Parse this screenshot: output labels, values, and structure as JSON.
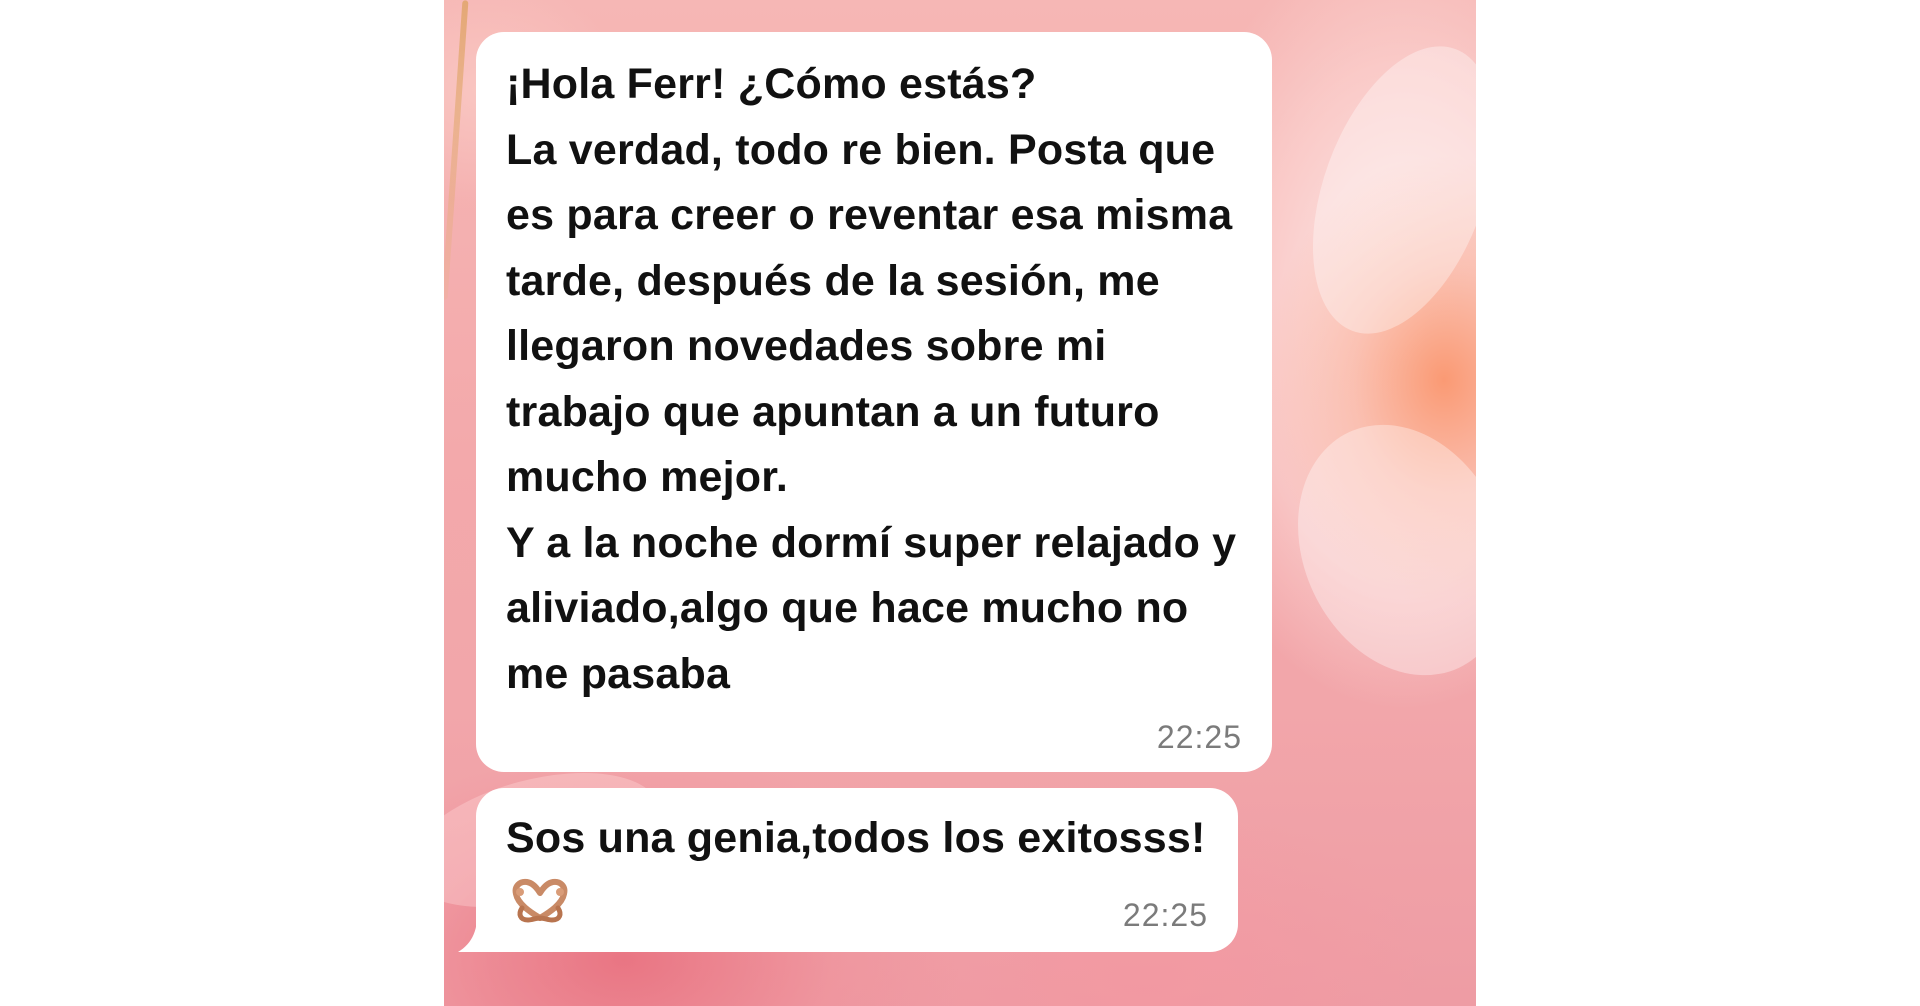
{
  "chat": {
    "messages": [
      {
        "text": "¡Hola Ferr! ¿Cómo estás?\nLa verdad, todo re bien. Posta que es para creer o reventar esa misma tarde, después de la sesión, me llegaron novedades sobre mi trabajo que apuntan a un futuro mucho mejor.\nY a la noche dormí super relajado y aliviado,algo que hace mucho no me pasaba",
        "time": "22:25"
      },
      {
        "text": "Sos una genia,todos los exitosss!",
        "emoji": "heart-hands-emoji",
        "time": "22:25"
      }
    ]
  },
  "colors": {
    "bubble": "#ffffff",
    "text": "#111111",
    "timestamp": "#7b7b7b",
    "wallpaper": "#f3a9ab"
  }
}
